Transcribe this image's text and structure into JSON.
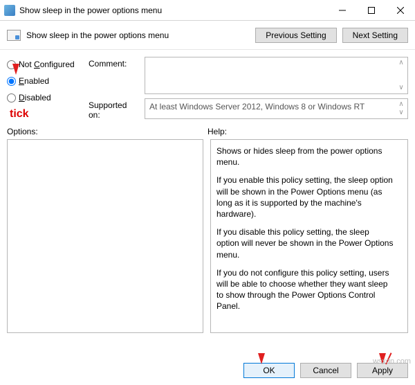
{
  "window": {
    "title": "Show sleep in the power options menu"
  },
  "subheader": {
    "title": "Show sleep in the power options menu",
    "prev_btn": "Previous Setting",
    "next_btn": "Next Setting"
  },
  "radios": {
    "not_configured": "Not Configured",
    "enabled": "Enabled",
    "disabled": "Disabled",
    "selected": "enabled"
  },
  "fields": {
    "comment_label": "Comment:",
    "comment_value": "",
    "supported_label": "Supported on:",
    "supported_value": "At least Windows Server 2012, Windows 8 or Windows RT"
  },
  "sections": {
    "options_label": "Options:",
    "help_label": "Help:"
  },
  "help": {
    "p1": "Shows or hides sleep from the power options menu.",
    "p2": "If you enable this policy setting, the sleep option will be shown in the Power Options menu (as long as it is supported by the machine's hardware).",
    "p3": "If you disable this policy setting, the sleep option will never be shown in the Power Options menu.",
    "p4": "If you do not configure this policy setting, users will be able to choose whether they want sleep to show through the Power Options Control Panel."
  },
  "footer": {
    "ok": "OK",
    "cancel": "Cancel",
    "apply": "Apply"
  },
  "annotations": {
    "tick": "tick"
  },
  "watermark": "wsxdn.com"
}
